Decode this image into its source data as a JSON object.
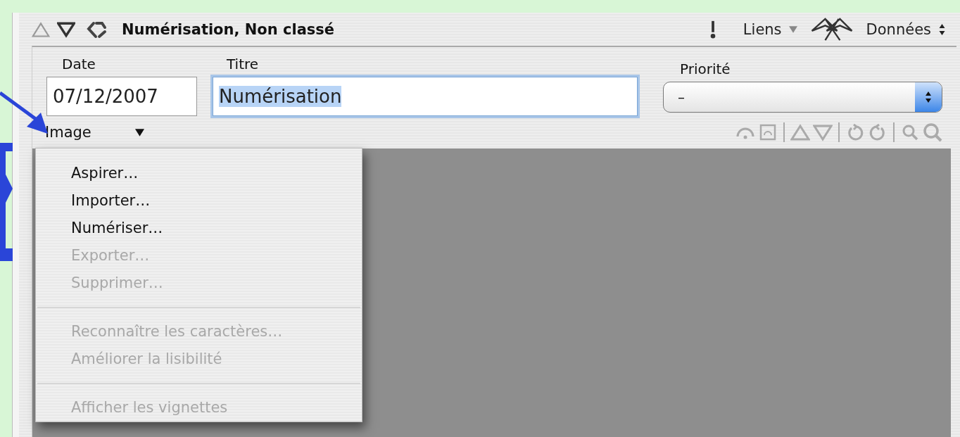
{
  "header": {
    "title": "Numérisation, Non classé",
    "links_label": "Liens",
    "data_label": "Données"
  },
  "fields": {
    "date": {
      "label": "Date",
      "value": "07/12/2007"
    },
    "title": {
      "label": "Titre",
      "value": "Numérisation",
      "focused": true,
      "text_selected": true
    },
    "priority": {
      "label": "Priorité",
      "value": "–"
    }
  },
  "image_menu": {
    "label": "Image",
    "groups": [
      [
        {
          "label": "Aspirer…",
          "disabled": false
        },
        {
          "label": "Importer…",
          "disabled": false
        },
        {
          "label": "Numériser…",
          "disabled": false
        },
        {
          "label": "Exporter…",
          "disabled": true
        },
        {
          "label": "Supprimer…",
          "disabled": true
        }
      ],
      [
        {
          "label": "Reconnaître les caractères…",
          "disabled": true
        },
        {
          "label": "Améliorer la lisibilité",
          "disabled": true
        }
      ],
      [
        {
          "label": "Afficher les vignettes",
          "disabled": true
        }
      ]
    ]
  }
}
